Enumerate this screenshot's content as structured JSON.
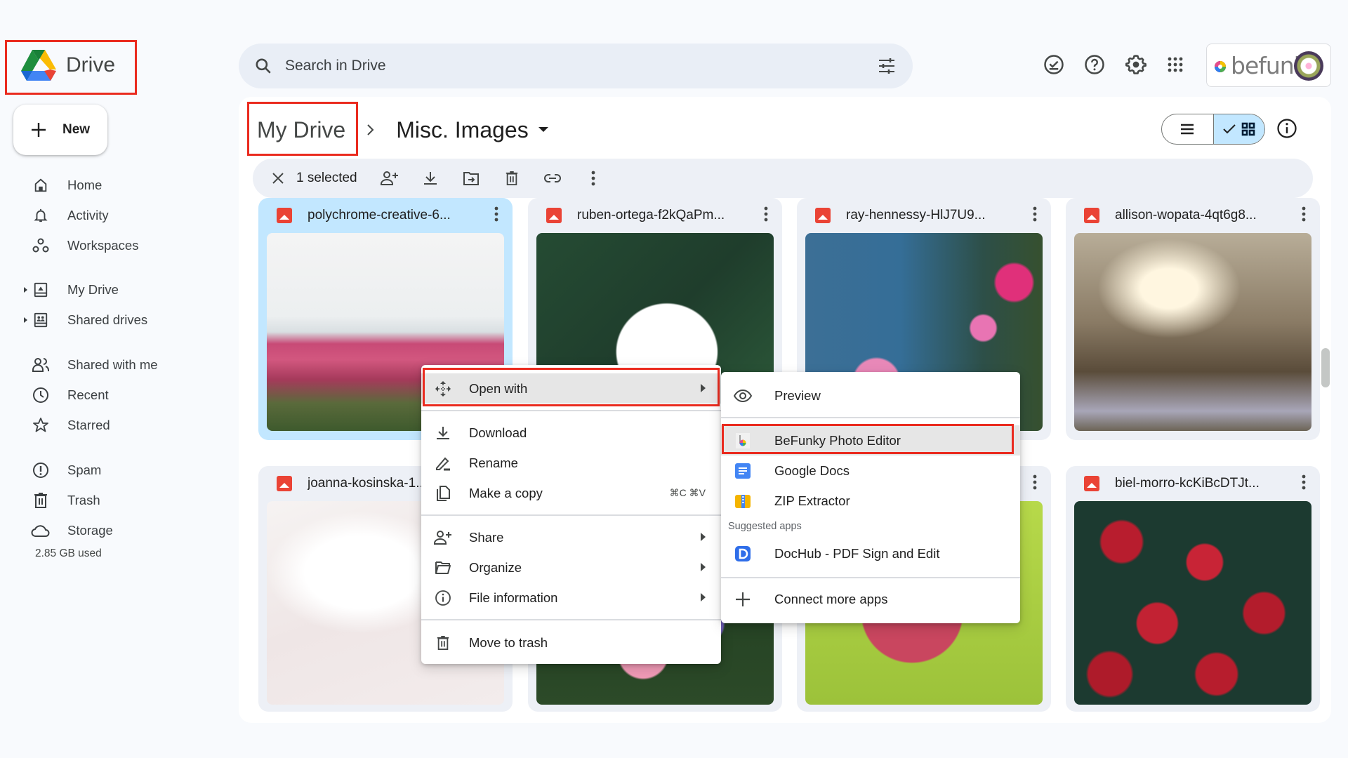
{
  "app": {
    "title": "Drive"
  },
  "new_button": {
    "label": "New"
  },
  "sidebar": {
    "items": [
      {
        "label": "Home",
        "icon": "home-icon"
      },
      {
        "label": "Activity",
        "icon": "bell-icon"
      },
      {
        "label": "Workspaces",
        "icon": "workspaces-icon"
      },
      {
        "label": "My Drive",
        "icon": "my-drive-icon"
      },
      {
        "label": "Shared drives",
        "icon": "shared-drives-icon"
      },
      {
        "label": "Shared with me",
        "icon": "people-icon"
      },
      {
        "label": "Recent",
        "icon": "clock-icon"
      },
      {
        "label": "Starred",
        "icon": "star-icon"
      },
      {
        "label": "Spam",
        "icon": "spam-icon"
      },
      {
        "label": "Trash",
        "icon": "trash-icon"
      },
      {
        "label": "Storage",
        "icon": "cloud-icon"
      }
    ],
    "storage_used": "2.85 GB used"
  },
  "search": {
    "placeholder": "Search in Drive"
  },
  "account": {
    "brand": "befunky"
  },
  "breadcrumb": {
    "root": "My Drive",
    "current": "Misc. Images"
  },
  "selection_bar": {
    "count_label": "1 selected"
  },
  "files": [
    {
      "name": "polychrome-creative-6...",
      "selected": true
    },
    {
      "name": "ruben-ortega-f2kQaPm...",
      "selected": false
    },
    {
      "name": "ray-hennessy-HlJ7U9...",
      "selected": false
    },
    {
      "name": "allison-wopata-4qt6g8...",
      "selected": false
    },
    {
      "name": "joanna-kosinska-1...",
      "selected": false
    },
    {
      "name": "",
      "selected": false
    },
    {
      "name": "",
      "selected": false
    },
    {
      "name": "biel-morro-kcKiBcDTJt...",
      "selected": false
    }
  ],
  "context_menu": {
    "items": [
      {
        "label": "Open with",
        "submenu": true,
        "highlighted": true
      },
      {
        "label": "Download"
      },
      {
        "label": "Rename"
      },
      {
        "label": "Make a copy",
        "shortcut": "⌘C ⌘V"
      },
      {
        "label": "Share",
        "submenu": true
      },
      {
        "label": "Organize",
        "submenu": true
      },
      {
        "label": "File information",
        "submenu": true
      },
      {
        "label": "Move to trash"
      }
    ]
  },
  "open_with_menu": {
    "items": [
      {
        "label": "Preview"
      },
      {
        "label": "BeFunky Photo Editor",
        "highlighted": true
      },
      {
        "label": "Google Docs"
      },
      {
        "label": "ZIP Extractor"
      }
    ],
    "suggested_label": "Suggested apps",
    "suggested": [
      {
        "label": "DocHub - PDF Sign and Edit"
      }
    ],
    "connect_label": "Connect more apps"
  }
}
